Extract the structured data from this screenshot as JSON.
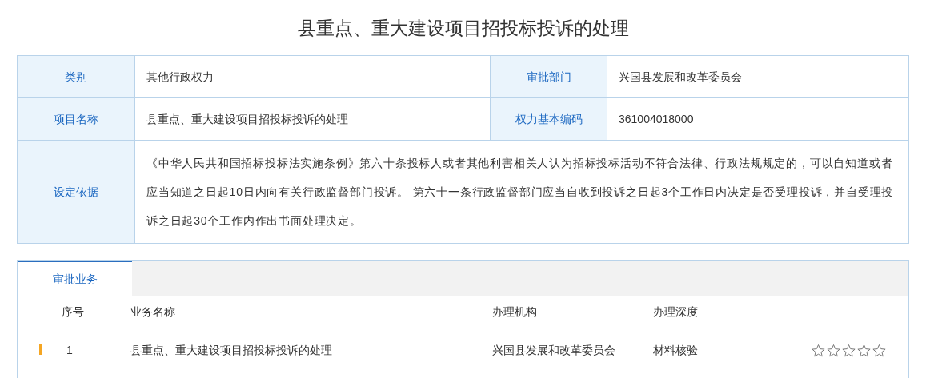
{
  "title": "县重点、重大建设项目招投标投诉的处理",
  "info_rows": [
    {
      "cells": [
        {
          "label": "类别",
          "value": "其他行政权力"
        },
        {
          "label": "审批部门",
          "value": "兴国县发展和改革委员会"
        }
      ]
    },
    {
      "cells": [
        {
          "label": "项目名称",
          "value": "县重点、重大建设项目招投标投诉的处理"
        },
        {
          "label": "权力基本编码",
          "value": "361004018000"
        }
      ]
    },
    {
      "cells": [
        {
          "label": "设定依据",
          "value": "《中华人民共和国招标投标法实施条例》第六十条投标人或者其他利害相关人认为招标投标活动不符合法律、行政法规规定的，可以自知道或者应当知道之日起10日内向有关行政监督部门投诉。 第六十一条行政监督部门应当自收到投诉之日起3个工作日内决定是否受理投诉，并自受理投诉之日起30个工作内作出书面处理决定。"
        }
      ]
    }
  ],
  "tabs": [
    {
      "label": "审批业务",
      "selected": true
    }
  ],
  "table": {
    "columns": [
      "序号",
      "业务名称",
      "办理机构",
      "办理深度"
    ],
    "rows": [
      {
        "cells": [
          "1",
          "县重点、重大建设项目招投标投诉的处理",
          "兴国县发展和改革委员会",
          "材料核验"
        ],
        "stars": 0
      }
    ]
  }
}
